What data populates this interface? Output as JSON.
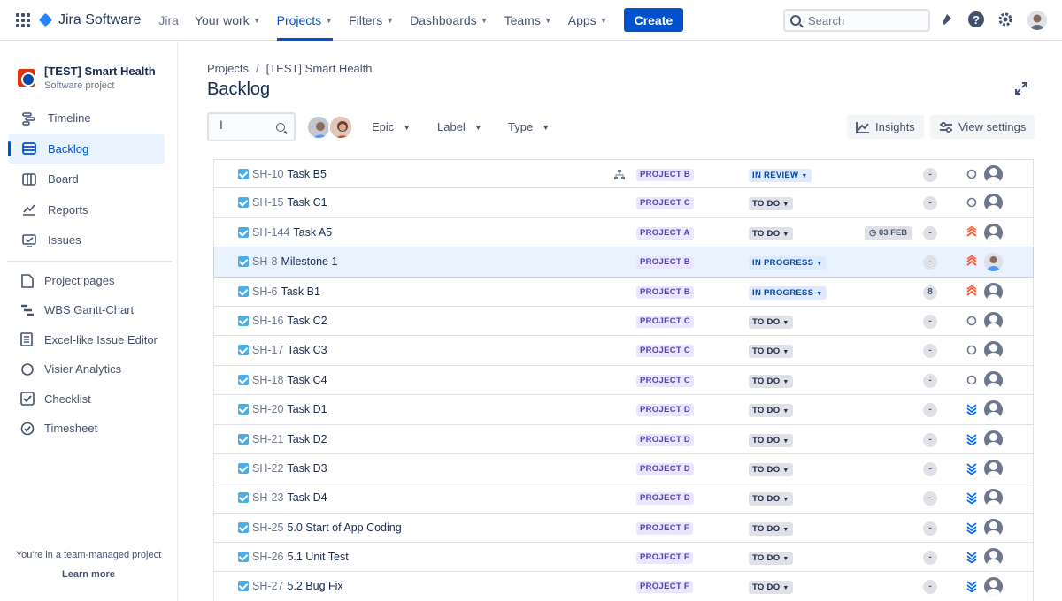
{
  "topnav": {
    "logo": "Jira Software",
    "jira": "Jira",
    "items": [
      {
        "label": "Your work"
      },
      {
        "label": "Projects",
        "active": true
      },
      {
        "label": "Filters"
      },
      {
        "label": "Dashboards"
      },
      {
        "label": "Teams"
      },
      {
        "label": "Apps"
      }
    ],
    "create_label": "Create",
    "search_placeholder": "Search"
  },
  "sidebar": {
    "project_name": "[TEST] Smart Health",
    "project_type": "Software project",
    "items": [
      {
        "label": "Timeline",
        "icon": "timeline-icon"
      },
      {
        "label": "Backlog",
        "icon": "backlog-icon",
        "active": true
      },
      {
        "label": "Board",
        "icon": "board-icon"
      },
      {
        "label": "Reports",
        "icon": "reports-icon"
      },
      {
        "label": "Issues",
        "icon": "issues-icon"
      }
    ],
    "apps": [
      {
        "label": "Project pages",
        "icon": "document-icon"
      },
      {
        "label": "WBS Gantt-Chart",
        "icon": "gantt-icon"
      },
      {
        "label": "Excel-like Issue Editor",
        "icon": "spreadsheet-icon"
      },
      {
        "label": "Visier Analytics",
        "icon": "circle-icon"
      },
      {
        "label": "Checklist",
        "icon": "checkbox-icon"
      },
      {
        "label": "Timesheet",
        "icon": "check-circle-icon"
      }
    ],
    "footer_note": "You're in a team-managed project",
    "learn_more": "Learn more"
  },
  "breadcrumb": {
    "root": "Projects",
    "sep": "/",
    "project": "[TEST] Smart Health"
  },
  "page_title": "Backlog",
  "filters": {
    "epic": "Epic",
    "label": "Label",
    "type": "Type"
  },
  "toolbar": {
    "insights": "Insights",
    "view_settings": "View settings"
  },
  "issues": [
    {
      "key": "SH-10",
      "summary": "Task B5",
      "epic": "PROJECT B",
      "status": "IN REVIEW",
      "status_type": "inreview",
      "estimate": "-",
      "priority": "medium",
      "child": true,
      "assignee": "placeholder"
    },
    {
      "key": "SH-15",
      "summary": "Task C1",
      "epic": "PROJECT C",
      "status": "TO DO",
      "status_type": "todo",
      "estimate": "-",
      "priority": "medium",
      "assignee": "placeholder"
    },
    {
      "key": "SH-144",
      "summary": "Task A5",
      "epic": "PROJECT A",
      "status": "TO DO",
      "status_type": "todo",
      "date": "03 FEB",
      "estimate": "-",
      "priority": "highest",
      "assignee": "placeholder"
    },
    {
      "key": "SH-8",
      "summary": "Milestone 1",
      "epic": "PROJECT B",
      "status": "IN PROGRESS",
      "status_type": "inprogress",
      "estimate": "-",
      "priority": "highest",
      "assignee": "photo",
      "highlight": true
    },
    {
      "key": "SH-6",
      "summary": "Task B1",
      "epic": "PROJECT B",
      "status": "IN PROGRESS",
      "status_type": "inprogress",
      "estimate": "8",
      "priority": "highest",
      "assignee": "placeholder"
    },
    {
      "key": "SH-16",
      "summary": "Task C2",
      "epic": "PROJECT C",
      "status": "TO DO",
      "status_type": "todo",
      "estimate": "-",
      "priority": "medium",
      "assignee": "placeholder"
    },
    {
      "key": "SH-17",
      "summary": "Task C3",
      "epic": "PROJECT C",
      "status": "TO DO",
      "status_type": "todo",
      "estimate": "-",
      "priority": "medium",
      "assignee": "placeholder"
    },
    {
      "key": "SH-18",
      "summary": "Task C4",
      "epic": "PROJECT C",
      "status": "TO DO",
      "status_type": "todo",
      "estimate": "-",
      "priority": "medium",
      "assignee": "placeholder"
    },
    {
      "key": "SH-20",
      "summary": "Task D1",
      "epic": "PROJECT D",
      "status": "TO DO",
      "status_type": "todo",
      "estimate": "-",
      "priority": "lowest",
      "assignee": "placeholder"
    },
    {
      "key": "SH-21",
      "summary": "Task D2",
      "epic": "PROJECT D",
      "status": "TO DO",
      "status_type": "todo",
      "estimate": "-",
      "priority": "lowest",
      "assignee": "placeholder"
    },
    {
      "key": "SH-22",
      "summary": "Task D3",
      "epic": "PROJECT D",
      "status": "TO DO",
      "status_type": "todo",
      "estimate": "-",
      "priority": "lowest",
      "assignee": "placeholder"
    },
    {
      "key": "SH-23",
      "summary": "Task D4",
      "epic": "PROJECT D",
      "status": "TO DO",
      "status_type": "todo",
      "estimate": "-",
      "priority": "lowest",
      "assignee": "placeholder"
    },
    {
      "key": "SH-25",
      "summary": "5.0 Start of App Coding",
      "epic": "PROJECT F",
      "status": "TO DO",
      "status_type": "todo",
      "estimate": "-",
      "priority": "lowest",
      "assignee": "placeholder"
    },
    {
      "key": "SH-26",
      "summary": "5.1 Unit Test",
      "epic": "PROJECT F",
      "status": "TO DO",
      "status_type": "todo",
      "estimate": "-",
      "priority": "lowest",
      "assignee": "placeholder"
    },
    {
      "key": "SH-27",
      "summary": "5.2 Bug Fix",
      "epic": "PROJECT F",
      "status": "TO DO",
      "status_type": "todo",
      "estimate": "-",
      "priority": "lowest",
      "assignee": "placeholder"
    }
  ],
  "colors": {
    "brand": "#0052cc",
    "epic_bg": "#eae6ff",
    "epic_fg": "#5243aa",
    "priority_high": "#ff5630",
    "priority_low": "#0065ff"
  }
}
